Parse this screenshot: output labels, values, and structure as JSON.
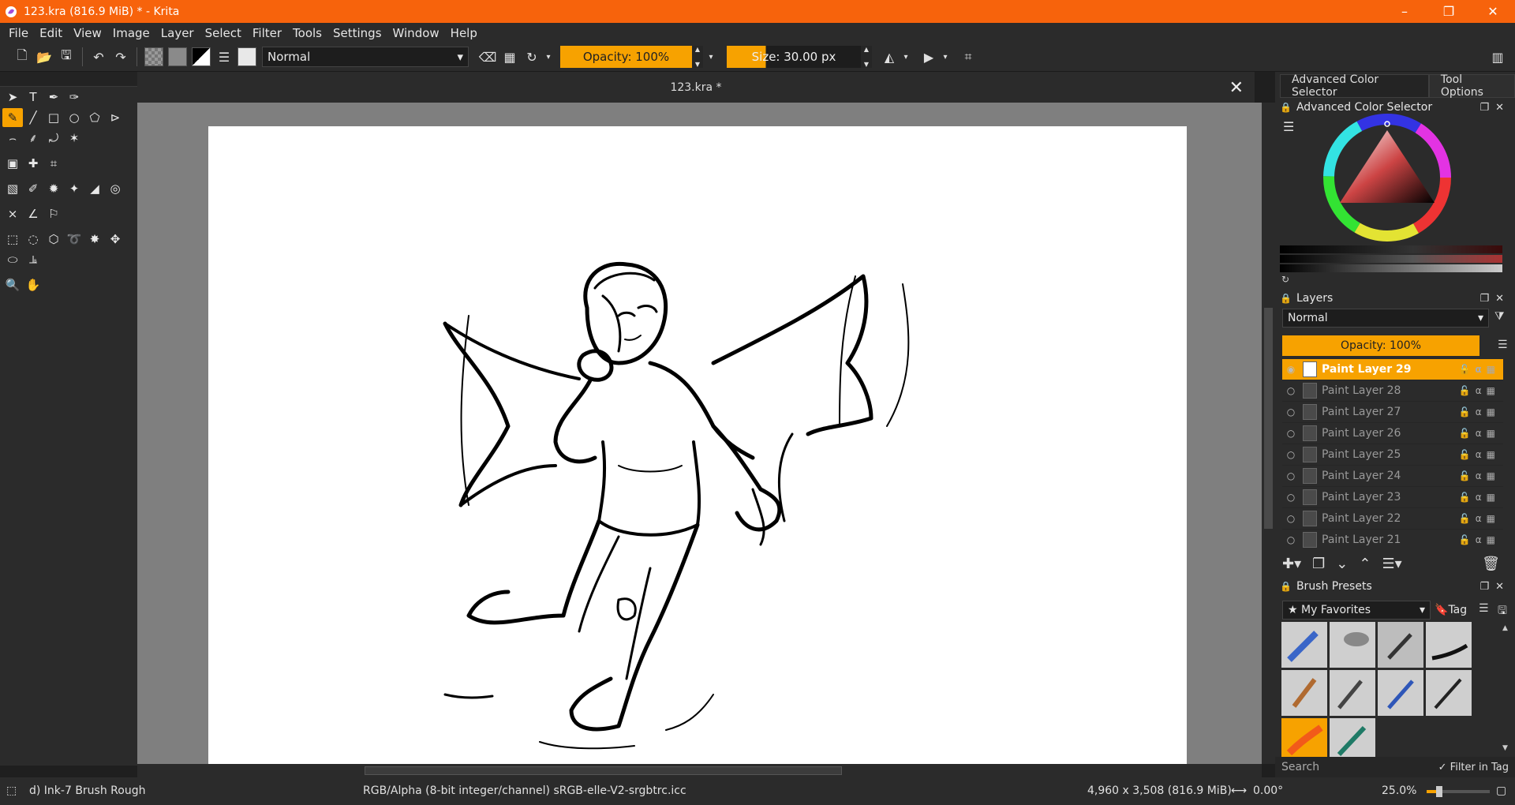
{
  "window": {
    "title": "123.kra (816.9 MiB)  * - Krita",
    "minimize_icon": "minimize-icon",
    "maximize_icon": "restore-icon",
    "close_icon": "close-icon"
  },
  "menu": [
    "File",
    "Edit",
    "View",
    "Image",
    "Layer",
    "Select",
    "Filter",
    "Tools",
    "Settings",
    "Window",
    "Help"
  ],
  "toolbar": {
    "blend_mode": "Normal",
    "opacity_label": "Opacity: 100%",
    "size_label": "Size: 30.00 px"
  },
  "document": {
    "tab_name": "123.kra *"
  },
  "dock": {
    "tabs": [
      "Advanced Color Selector",
      "Tool Options"
    ],
    "color_selector_title": "Advanced Color Selector",
    "layers_title": "Layers",
    "layers_blend": "Normal",
    "layers_opacity": "Opacity:  100%",
    "layers": [
      {
        "name": "Paint Layer 29",
        "active": true
      },
      {
        "name": "Paint Layer 28",
        "active": false
      },
      {
        "name": "Paint Layer 27",
        "active": false
      },
      {
        "name": "Paint Layer 26",
        "active": false
      },
      {
        "name": "Paint Layer 25",
        "active": false
      },
      {
        "name": "Paint Layer 24",
        "active": false
      },
      {
        "name": "Paint Layer 23",
        "active": false
      },
      {
        "name": "Paint Layer 22",
        "active": false
      },
      {
        "name": "Paint Layer 21",
        "active": false
      }
    ],
    "presets_title": "Brush Presets",
    "presets_tag": "My Favorites",
    "tag_label": "Tag",
    "search_placeholder": "Search",
    "filter_in_tag": "Filter in Tag"
  },
  "status": {
    "brush": "d) Ink-7 Brush Rough",
    "color_space": "RGB/Alpha (8-bit integer/channel)  sRGB-elle-V2-srgbtrc.icc",
    "dimensions": "4,960 x 3,508 (816.9 MiB)",
    "rotation": "0.00°",
    "zoom": "25.0%"
  },
  "colors": {
    "titlebar": "#f7630c",
    "accent": "#f7a200",
    "panel": "#2b2b2b",
    "canvas_bg": "#7f7f7f"
  }
}
